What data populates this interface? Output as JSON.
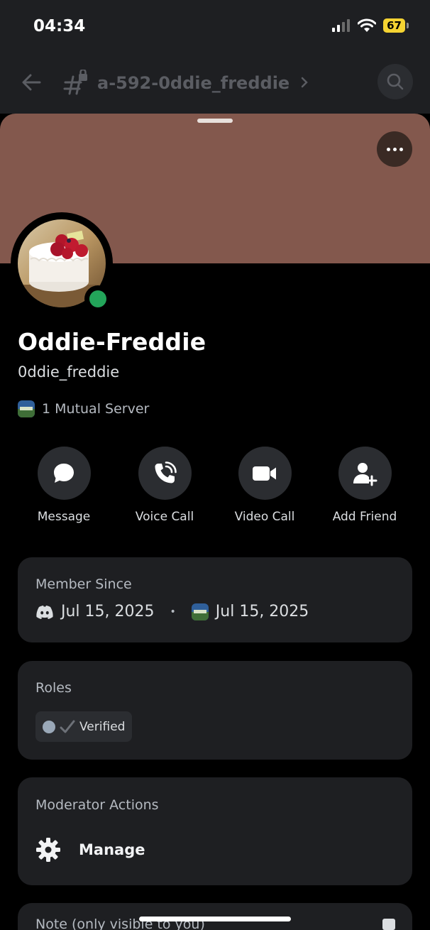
{
  "status_bar": {
    "time": "04:34",
    "battery": "67",
    "battery_color": "#f5d332"
  },
  "channel_header": {
    "name": "a-592-0ddie_freddie",
    "back_icon": "arrow-left-icon",
    "channel_icon": "locked-hash-icon",
    "search_icon": "search-icon"
  },
  "profile": {
    "banner_color": "#83584d",
    "display_name": "Oddie-Freddie",
    "username": "0ddie_freddie",
    "mutual_servers": "1 Mutual Server",
    "status_color": "#23a55a"
  },
  "actions": [
    {
      "label": "Message",
      "icon": "chat-bubble-icon"
    },
    {
      "label": "Voice Call",
      "icon": "phone-call-icon"
    },
    {
      "label": "Video Call",
      "icon": "video-camera-icon"
    },
    {
      "label": "Add Friend",
      "icon": "add-friend-icon"
    }
  ],
  "member_since": {
    "title": "Member Since",
    "discord_date": "Jul 15, 2025",
    "separator": "•",
    "server_date": "Jul 15, 2025"
  },
  "roles": {
    "title": "Roles",
    "items": [
      {
        "label": "Verified"
      }
    ]
  },
  "moderator": {
    "title": "Moderator Actions",
    "manage_label": "Manage"
  },
  "note": {
    "title": "Note (only visible to you)"
  }
}
